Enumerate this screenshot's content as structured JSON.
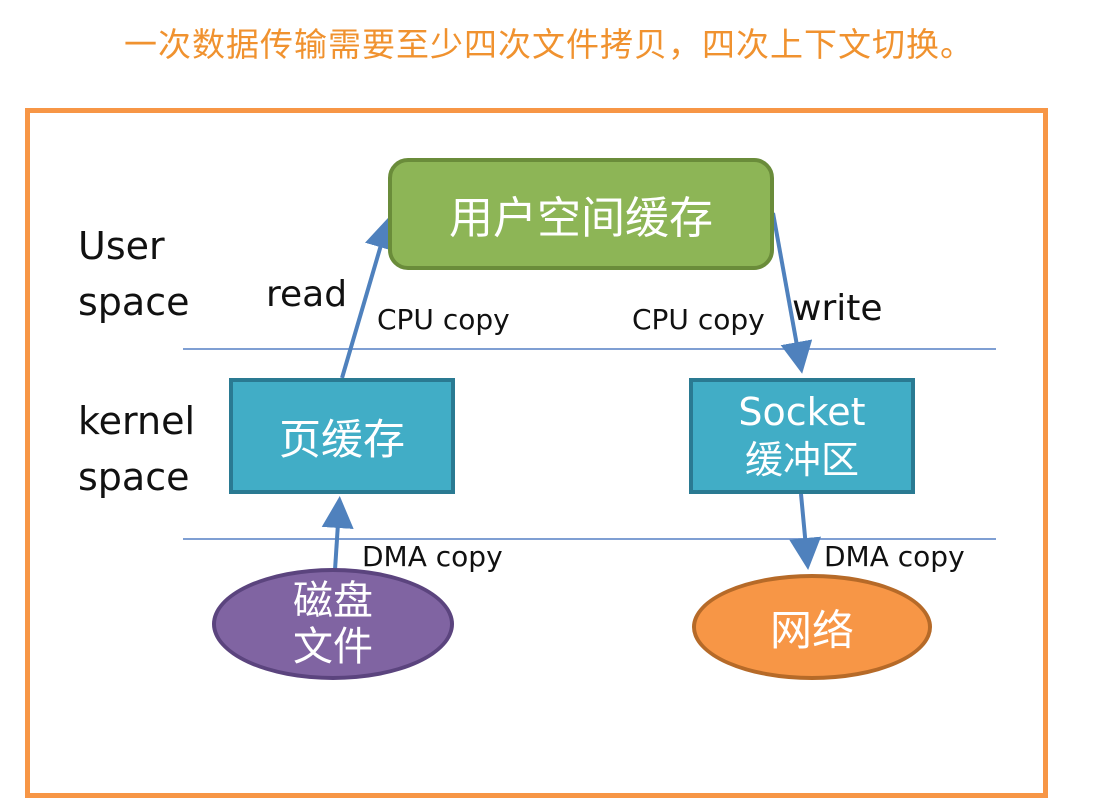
{
  "caption": "一次数据传输需要至少四次文件拷贝，四次上下文切换。",
  "layers": {
    "user_space": [
      "User",
      "space"
    ],
    "kernel_space": [
      "kernel",
      "space"
    ]
  },
  "operations": {
    "read": "read",
    "write": "write"
  },
  "copy_labels": {
    "read_cpu": "CPU copy",
    "write_cpu": "CPU copy",
    "read_dma": "DMA copy",
    "write_dma": "DMA copy"
  },
  "nodes": {
    "user_buffer": "用户空间缓存",
    "page_cache": "页缓存",
    "socket_buffer": [
      "Socket",
      "缓冲区"
    ],
    "disk_file": [
      "磁盘",
      "文件"
    ],
    "network": "网络"
  },
  "colors": {
    "caption": "#f0922f",
    "frame": "#f79646",
    "user_buffer": "#8db556",
    "kernel_buffer": "#41adc6",
    "disk_file": "#8064a2",
    "network": "#f79646",
    "arrow": "#4f81bd",
    "divider": "#7f9fd3"
  }
}
